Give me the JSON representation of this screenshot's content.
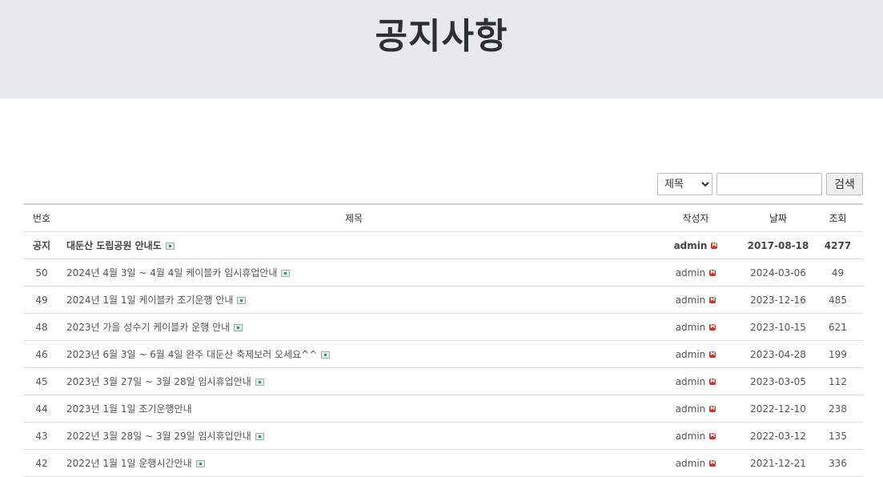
{
  "header": {
    "title": "공지사항"
  },
  "search": {
    "field_selected": "제목",
    "field_options": [
      "제목"
    ],
    "query": "",
    "button_label": "검색"
  },
  "table": {
    "columns": {
      "num": "번호",
      "title": "제목",
      "author": "작성자",
      "date": "날짜",
      "views": "조회"
    },
    "rows": [
      {
        "num": "공지",
        "title": "대둔산 도립공원 안내도",
        "attach": true,
        "author": "admin",
        "date": "2017-08-18",
        "views": "4277",
        "notice": true
      },
      {
        "num": "50",
        "title": "2024년 4월 3일 ~ 4월 4일 케이블카 임시휴업안내",
        "attach": true,
        "author": "admin",
        "date": "2024-03-06",
        "views": "49"
      },
      {
        "num": "49",
        "title": "2024년 1월 1일 케이블카 조기운행 안내",
        "attach": true,
        "author": "admin",
        "date": "2023-12-16",
        "views": "485"
      },
      {
        "num": "48",
        "title": "2023년 가을 성수기 케이블카 운행 안내",
        "attach": true,
        "author": "admin",
        "date": "2023-10-15",
        "views": "621"
      },
      {
        "num": "46",
        "title": "2023년 6월 3일 ~ 6월 4일 완주 대둔산 축제보러 오세요^^",
        "attach": true,
        "author": "admin",
        "date": "2023-04-28",
        "views": "199"
      },
      {
        "num": "45",
        "title": "2023년 3월 27일 ~ 3월 28일 임시휴업안내",
        "attach": true,
        "author": "admin",
        "date": "2023-03-05",
        "views": "112"
      },
      {
        "num": "44",
        "title": "2023년 1월 1일 조기운행안내",
        "attach": false,
        "author": "admin",
        "date": "2022-12-10",
        "views": "238"
      },
      {
        "num": "43",
        "title": "2022년 3월 28일 ~ 3월 29일 임시휴업안내",
        "attach": true,
        "author": "admin",
        "date": "2022-03-12",
        "views": "135"
      },
      {
        "num": "42",
        "title": "2022년 1월 1일 운행시간안내",
        "attach": true,
        "author": "admin",
        "date": "2021-12-21",
        "views": "336"
      }
    ]
  },
  "icons": {
    "attachment": "attachment-image-icon",
    "author_mail": "mail-icon"
  },
  "colors": {
    "banner_bg": "#e6e9ee",
    "mail_icon": "#c0392b"
  }
}
